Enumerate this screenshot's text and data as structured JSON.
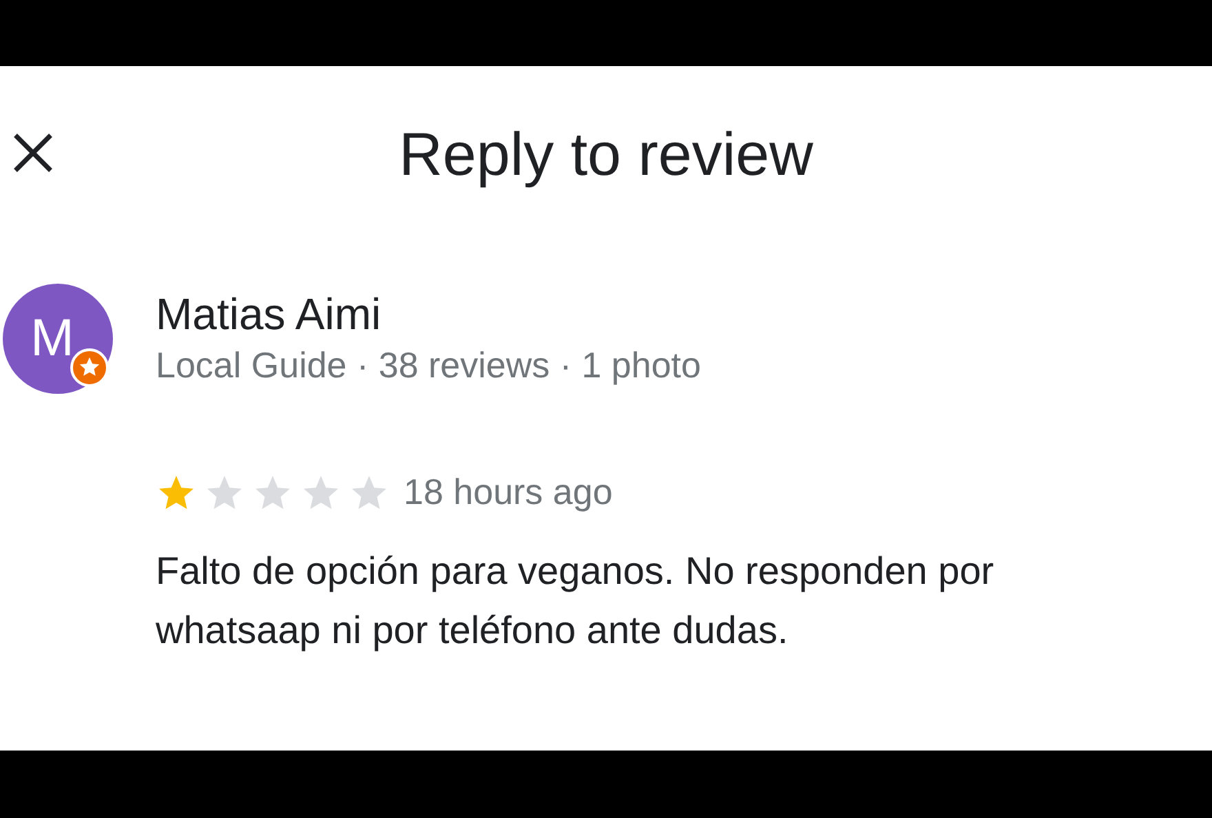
{
  "header": {
    "title": "Reply to review"
  },
  "review": {
    "avatar_letter": "M",
    "local_guide": true,
    "name": "Matias Aimi",
    "meta": "Local Guide · 38 reviews · 1 photo",
    "stars": 1,
    "time": "18 hours ago",
    "text": "Falto de opción para veganos. No responden por whatsaap ni por teléfono ante dudas."
  }
}
